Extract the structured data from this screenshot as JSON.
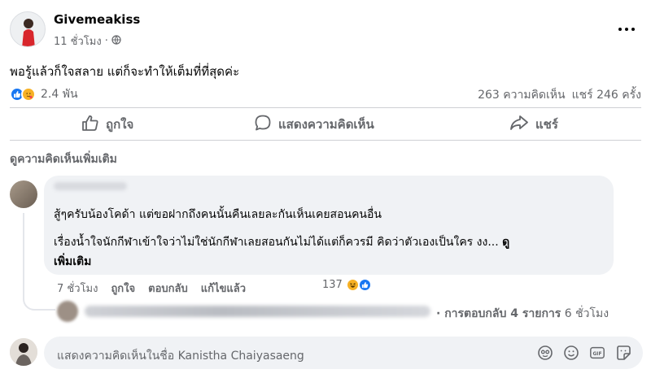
{
  "post": {
    "author": "Givemeakiss",
    "time": "11 ชั่วโมง",
    "text": "พอรู้แล้วก็ใจสลาย แต่ก็จะทำให้เต็มที่ที่สุดค่ะ",
    "reaction_count": "2.4 พัน",
    "comments_count": "263 ความคิดเห็น",
    "shares_count": "แชร์ 246 ครั้ง"
  },
  "actions": {
    "like": "ถูกใจ",
    "comment": "แสดงความคิดเห็น",
    "share": "แชร์"
  },
  "view_more_comments": "ดูความคิดเห็นเพิ่มเติม",
  "comment": {
    "line1": "สู้ๆครับน้องโคด้า แต่ขอฝากถึงคนนั้นคืนเลยละกันเห็นเคยสอนคนอื่น",
    "line2": "เรื่องน้ำใจนักกีฬาเข้าใจว่าไม่ใช่นักกีฬาเลยสอนกันไม่ได้แต่ก็ควรมี คิดว่าตัวเองเป็นใคร งง...",
    "see_more_a": "ดู",
    "see_more_b": "เพิ่มเติม",
    "time": "7 ชั่วโมง",
    "like": "ถูกใจ",
    "reply": "ตอบกลับ",
    "edited": "แก้ไขแล้ว",
    "reaction_count": "137"
  },
  "replies": {
    "label": "· การตอบกลับ 4 รายการ",
    "time": "6 ชั่วโมง"
  },
  "composer": {
    "placeholder": "แสดงความคิดเห็นในชื่อ Kanistha Chaiyasaeng"
  },
  "colors": {
    "accent": "#1877f2",
    "muted_text": "#65676b",
    "bubble_bg": "#f0f2f5"
  }
}
